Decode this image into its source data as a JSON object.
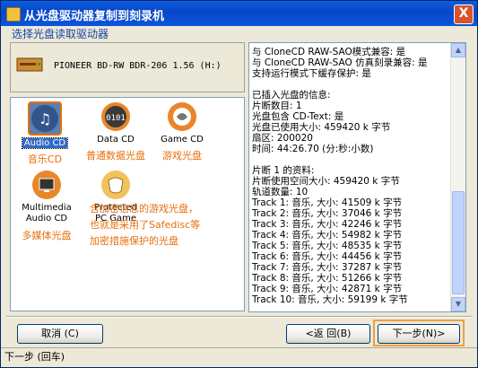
{
  "window": {
    "title": "从光盘驱动器复制到刻录机",
    "close_label": "X"
  },
  "subtitle": "选择光盘读取驱动器",
  "drive": {
    "label": "PIONEER BD-RW   BDR-206 1.56 (H:)"
  },
  "disc_types": [
    {
      "label": "Audio CD",
      "cn": "音乐CD",
      "icon": "music-note-icon",
      "selected": true
    },
    {
      "label": "Data CD",
      "cn": "普通数据光盘",
      "icon": "binary-data-icon"
    },
    {
      "label": "Game CD",
      "cn": "游戏光盘",
      "icon": "game-disc-icon"
    },
    {
      "label": "Multimedia\nAudio CD",
      "cn": "多媒体光盘",
      "icon": "monitor-icon"
    },
    {
      "label": "Protected\nPC Game",
      "cn": "",
      "icon": "protected-game-icon"
    }
  ],
  "protected_note": [
    "含加密信息的游戏光盘，",
    "也就是采用了Safedisc等",
    "加密措施保护的光盘"
  ],
  "info_lines": [
    "与 CloneCD RAW-SAO模式兼容: 是",
    "与 CloneCD RAW-SAO 仿真刻录兼容: 是",
    "支持运行模式下缓存保护: 是",
    "",
    "已插入光盘的信息:",
    "片断数目: 1",
    "光盘包含 CD-Text: 是",
    "光盘已使用大小: 459420 k 字节",
    "扇区: 200020",
    "时间: 44:26.70 (分:秒:小数)",
    "",
    "片断 1 的资料:",
    "片断使用空间大小: 459420 k 字节",
    "轨道数量: 10",
    "Track 1: 音乐, 大小: 41509 k 字节",
    "Track 2: 音乐, 大小: 37046 k 字节",
    "Track 3: 音乐, 大小: 42246 k 字节",
    "Track 4: 音乐, 大小: 54982 k 字节",
    "Track 5: 音乐, 大小: 48535 k 字节",
    "Track 6: 音乐, 大小: 44456 k 字节",
    "Track 7: 音乐, 大小: 37287 k 字节",
    "Track 8: 音乐, 大小: 51266 k 字节",
    "Track 9: 音乐, 大小: 42871 k 字节",
    "Track 10: 音乐, 大小: 59199 k 字节"
  ],
  "buttons": {
    "cancel": "取消 (C)",
    "back": "<返 回(B)",
    "next": "下一步(N)>"
  },
  "status": "下一步 (回车)",
  "colors": {
    "title_bar": "#0a55d8",
    "accent_orange": "#e86f0a",
    "selection": "#316ac5"
  }
}
